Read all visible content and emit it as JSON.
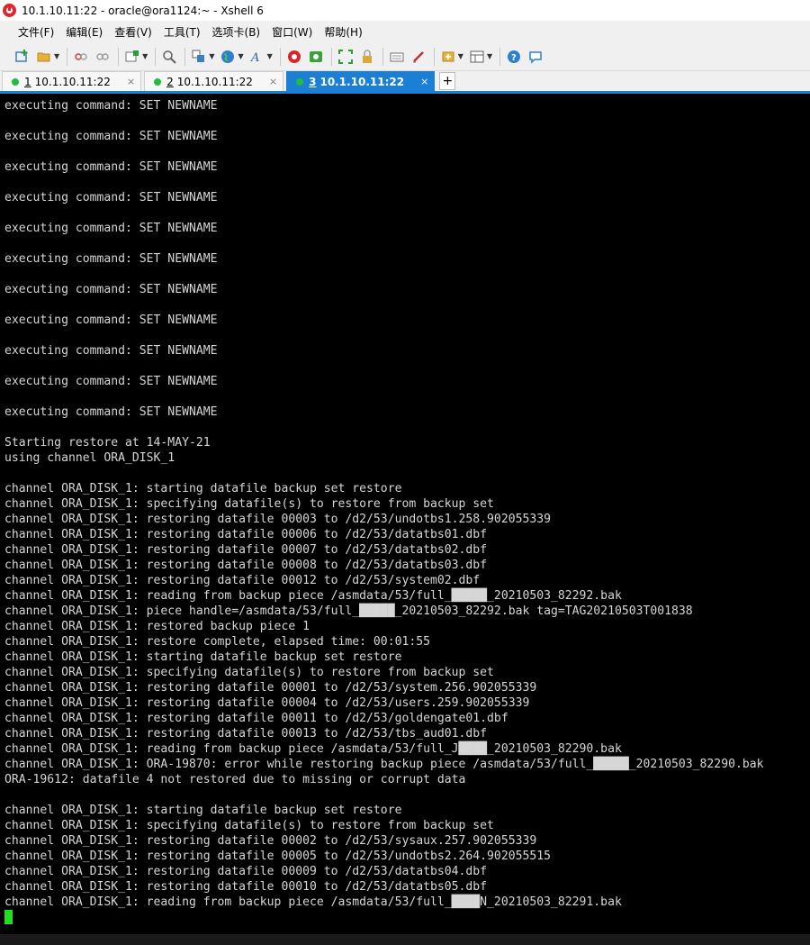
{
  "window": {
    "title": "10.1.10.11:22 - oracle@ora1124:~ - Xshell 6"
  },
  "menu": [
    {
      "label": "文件(F)"
    },
    {
      "label": "编辑(E)"
    },
    {
      "label": "查看(V)"
    },
    {
      "label": "工具(T)"
    },
    {
      "label": "选项卡(B)"
    },
    {
      "label": "窗口(W)"
    },
    {
      "label": "帮助(H)"
    }
  ],
  "tabs": [
    {
      "num": "1",
      "label": "10.1.10.11:22",
      "close": "×"
    },
    {
      "num": "2",
      "label": "10.1.10.11:22",
      "close": "×"
    },
    {
      "num": "3",
      "label": "10.1.10.11:22",
      "close": "×"
    }
  ],
  "tab_add": "+",
  "colors": {
    "accent": "#1b7fd4",
    "session_dot": "#1fbf3d",
    "cursor": "#1ee01e",
    "terminal_bg": "#000000",
    "terminal_fg": "#d6d6d6"
  },
  "icons": [
    "new-session-icon",
    "open-folder-icon",
    "disconnect-icon",
    "reconnect-icon",
    "new-tab-icon",
    "find-icon",
    "transfer-icon",
    "globe-icon",
    "font-icon",
    "xftp-icon",
    "xmanager-icon",
    "fullscreen-icon",
    "lock-icon",
    "keyboard-icon",
    "compose-icon",
    "new-file-icon",
    "layout-icon",
    "help-icon",
    "chat-icon"
  ],
  "terminal": {
    "lines": [
      "executing command: SET NEWNAME",
      "",
      "executing command: SET NEWNAME",
      "",
      "executing command: SET NEWNAME",
      "",
      "executing command: SET NEWNAME",
      "",
      "executing command: SET NEWNAME",
      "",
      "executing command: SET NEWNAME",
      "",
      "executing command: SET NEWNAME",
      "",
      "executing command: SET NEWNAME",
      "",
      "executing command: SET NEWNAME",
      "",
      "executing command: SET NEWNAME",
      "",
      "executing command: SET NEWNAME",
      "",
      "Starting restore at 14-MAY-21",
      "using channel ORA_DISK_1",
      "",
      "channel ORA_DISK_1: starting datafile backup set restore",
      "channel ORA_DISK_1: specifying datafile(s) to restore from backup set",
      "channel ORA_DISK_1: restoring datafile 00003 to /d2/53/undotbs1.258.902055339",
      "channel ORA_DISK_1: restoring datafile 00006 to /d2/53/datatbs01.dbf",
      "channel ORA_DISK_1: restoring datafile 00007 to /d2/53/datatbs02.dbf",
      "channel ORA_DISK_1: restoring datafile 00008 to /d2/53/datatbs03.dbf",
      "channel ORA_DISK_1: restoring datafile 00012 to /d2/53/system02.dbf",
      "channel ORA_DISK_1: reading from backup piece /asmdata/53/full_█████_20210503_82292.bak",
      "channel ORA_DISK_1: piece handle=/asmdata/53/full_█████_20210503_82292.bak tag=TAG20210503T001838",
      "channel ORA_DISK_1: restored backup piece 1",
      "channel ORA_DISK_1: restore complete, elapsed time: 00:01:55",
      "channel ORA_DISK_1: starting datafile backup set restore",
      "channel ORA_DISK_1: specifying datafile(s) to restore from backup set",
      "channel ORA_DISK_1: restoring datafile 00001 to /d2/53/system.256.902055339",
      "channel ORA_DISK_1: restoring datafile 00004 to /d2/53/users.259.902055339",
      "channel ORA_DISK_1: restoring datafile 00011 to /d2/53/goldengate01.dbf",
      "channel ORA_DISK_1: restoring datafile 00013 to /d2/53/tbs_aud01.dbf",
      "channel ORA_DISK_1: reading from backup piece /asmdata/53/full_J████_20210503_82290.bak",
      "channel ORA_DISK_1: ORA-19870: error while restoring backup piece /asmdata/53/full_█████_20210503_82290.bak",
      "ORA-19612: datafile 4 not restored due to missing or corrupt data",
      "",
      "channel ORA_DISK_1: starting datafile backup set restore",
      "channel ORA_DISK_1: specifying datafile(s) to restore from backup set",
      "channel ORA_DISK_1: restoring datafile 00002 to /d2/53/sysaux.257.902055339",
      "channel ORA_DISK_1: restoring datafile 00005 to /d2/53/undotbs2.264.902055515",
      "channel ORA_DISK_1: restoring datafile 00009 to /d2/53/datatbs04.dbf",
      "channel ORA_DISK_1: restoring datafile 00010 to /d2/53/datatbs05.dbf",
      "channel ORA_DISK_1: reading from backup piece /asmdata/53/full_████N_20210503_82291.bak"
    ]
  }
}
